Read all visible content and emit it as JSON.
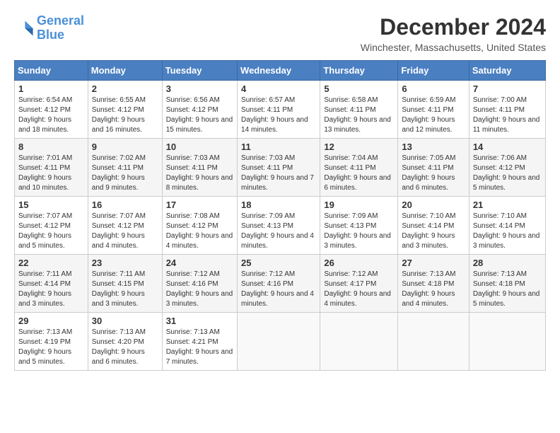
{
  "logo": {
    "line1": "General",
    "line2": "Blue"
  },
  "title": "December 2024",
  "location": "Winchester, Massachusetts, United States",
  "days_header": [
    "Sunday",
    "Monday",
    "Tuesday",
    "Wednesday",
    "Thursday",
    "Friday",
    "Saturday"
  ],
  "weeks": [
    [
      {
        "day": "1",
        "sunrise": "6:54 AM",
        "sunset": "4:12 PM",
        "daylight": "9 hours and 18 minutes."
      },
      {
        "day": "2",
        "sunrise": "6:55 AM",
        "sunset": "4:12 PM",
        "daylight": "9 hours and 16 minutes."
      },
      {
        "day": "3",
        "sunrise": "6:56 AM",
        "sunset": "4:12 PM",
        "daylight": "9 hours and 15 minutes."
      },
      {
        "day": "4",
        "sunrise": "6:57 AM",
        "sunset": "4:11 PM",
        "daylight": "9 hours and 14 minutes."
      },
      {
        "day": "5",
        "sunrise": "6:58 AM",
        "sunset": "4:11 PM",
        "daylight": "9 hours and 13 minutes."
      },
      {
        "day": "6",
        "sunrise": "6:59 AM",
        "sunset": "4:11 PM",
        "daylight": "9 hours and 12 minutes."
      },
      {
        "day": "7",
        "sunrise": "7:00 AM",
        "sunset": "4:11 PM",
        "daylight": "9 hours and 11 minutes."
      }
    ],
    [
      {
        "day": "8",
        "sunrise": "7:01 AM",
        "sunset": "4:11 PM",
        "daylight": "9 hours and 10 minutes."
      },
      {
        "day": "9",
        "sunrise": "7:02 AM",
        "sunset": "4:11 PM",
        "daylight": "9 hours and 9 minutes."
      },
      {
        "day": "10",
        "sunrise": "7:03 AM",
        "sunset": "4:11 PM",
        "daylight": "9 hours and 8 minutes."
      },
      {
        "day": "11",
        "sunrise": "7:03 AM",
        "sunset": "4:11 PM",
        "daylight": "9 hours and 7 minutes."
      },
      {
        "day": "12",
        "sunrise": "7:04 AM",
        "sunset": "4:11 PM",
        "daylight": "9 hours and 6 minutes."
      },
      {
        "day": "13",
        "sunrise": "7:05 AM",
        "sunset": "4:11 PM",
        "daylight": "9 hours and 6 minutes."
      },
      {
        "day": "14",
        "sunrise": "7:06 AM",
        "sunset": "4:12 PM",
        "daylight": "9 hours and 5 minutes."
      }
    ],
    [
      {
        "day": "15",
        "sunrise": "7:07 AM",
        "sunset": "4:12 PM",
        "daylight": "9 hours and 5 minutes."
      },
      {
        "day": "16",
        "sunrise": "7:07 AM",
        "sunset": "4:12 PM",
        "daylight": "9 hours and 4 minutes."
      },
      {
        "day": "17",
        "sunrise": "7:08 AM",
        "sunset": "4:12 PM",
        "daylight": "9 hours and 4 minutes."
      },
      {
        "day": "18",
        "sunrise": "7:09 AM",
        "sunset": "4:13 PM",
        "daylight": "9 hours and 4 minutes."
      },
      {
        "day": "19",
        "sunrise": "7:09 AM",
        "sunset": "4:13 PM",
        "daylight": "9 hours and 3 minutes."
      },
      {
        "day": "20",
        "sunrise": "7:10 AM",
        "sunset": "4:14 PM",
        "daylight": "9 hours and 3 minutes."
      },
      {
        "day": "21",
        "sunrise": "7:10 AM",
        "sunset": "4:14 PM",
        "daylight": "9 hours and 3 minutes."
      }
    ],
    [
      {
        "day": "22",
        "sunrise": "7:11 AM",
        "sunset": "4:14 PM",
        "daylight": "9 hours and 3 minutes."
      },
      {
        "day": "23",
        "sunrise": "7:11 AM",
        "sunset": "4:15 PM",
        "daylight": "9 hours and 3 minutes."
      },
      {
        "day": "24",
        "sunrise": "7:12 AM",
        "sunset": "4:16 PM",
        "daylight": "9 hours and 3 minutes."
      },
      {
        "day": "25",
        "sunrise": "7:12 AM",
        "sunset": "4:16 PM",
        "daylight": "9 hours and 4 minutes."
      },
      {
        "day": "26",
        "sunrise": "7:12 AM",
        "sunset": "4:17 PM",
        "daylight": "9 hours and 4 minutes."
      },
      {
        "day": "27",
        "sunrise": "7:13 AM",
        "sunset": "4:18 PM",
        "daylight": "9 hours and 4 minutes."
      },
      {
        "day": "28",
        "sunrise": "7:13 AM",
        "sunset": "4:18 PM",
        "daylight": "9 hours and 5 minutes."
      }
    ],
    [
      {
        "day": "29",
        "sunrise": "7:13 AM",
        "sunset": "4:19 PM",
        "daylight": "9 hours and 5 minutes."
      },
      {
        "day": "30",
        "sunrise": "7:13 AM",
        "sunset": "4:20 PM",
        "daylight": "9 hours and 6 minutes."
      },
      {
        "day": "31",
        "sunrise": "7:13 AM",
        "sunset": "4:21 PM",
        "daylight": "9 hours and 7 minutes."
      },
      null,
      null,
      null,
      null
    ]
  ]
}
